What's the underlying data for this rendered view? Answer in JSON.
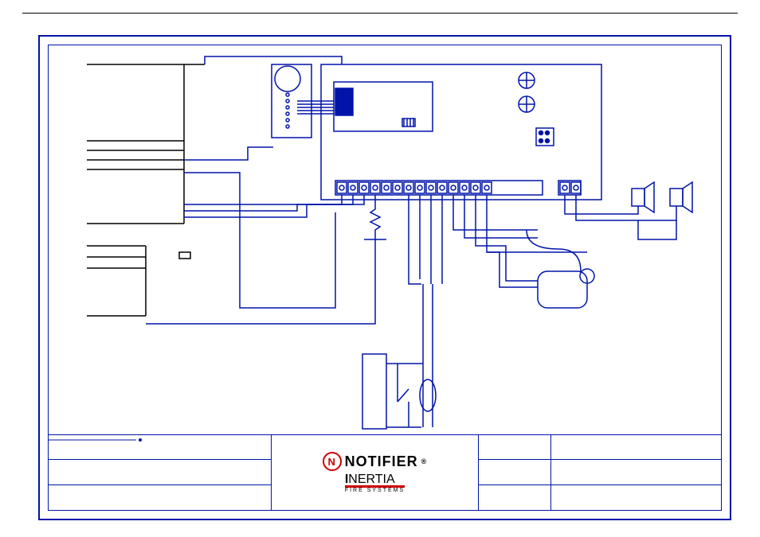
{
  "titleblock": {
    "brand1": "NOTIFIER",
    "brand1_reg": "®",
    "brand2_bold": "I",
    "brand2_rest": "NERTIA",
    "brand2_sub": "FIRE SYSTEMS"
  },
  "components": {
    "main_panel": "control-panel",
    "module": "module-board",
    "terminal_block": "terminal-block",
    "detector": "detector",
    "sounders": [
      "sounder-1",
      "sounder-2"
    ],
    "resistor": "eol-resistor",
    "relay_contact": "relay-contact",
    "door": "door-contact"
  }
}
